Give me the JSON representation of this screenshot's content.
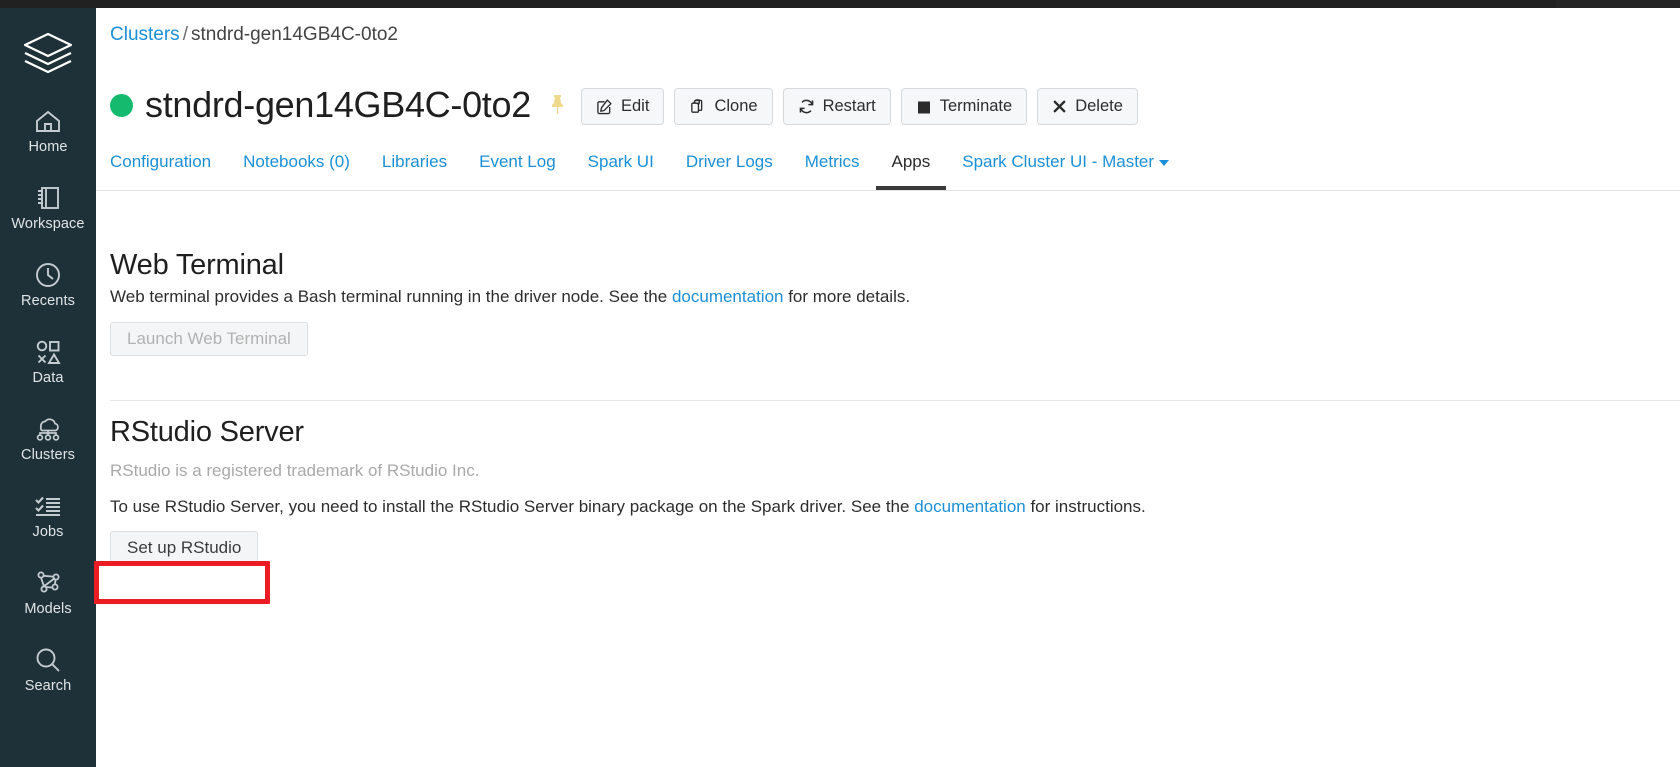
{
  "sidebar": {
    "logo_name": "databricks-logo",
    "items": [
      {
        "label": "Home",
        "icon": "home-icon"
      },
      {
        "label": "Workspace",
        "icon": "workspace-icon"
      },
      {
        "label": "Recents",
        "icon": "clock-icon"
      },
      {
        "label": "Data",
        "icon": "shapes-icon"
      },
      {
        "label": "Clusters",
        "icon": "clusters-cloud-icon"
      },
      {
        "label": "Jobs",
        "icon": "checklist-icon"
      },
      {
        "label": "Models",
        "icon": "graph-nodes-icon"
      },
      {
        "label": "Search",
        "icon": "search-icon"
      }
    ]
  },
  "breadcrumb": {
    "root": "Clusters",
    "separator": "/",
    "current": "stndrd-gen14GB4C-0to2"
  },
  "header": {
    "cluster_name": "stndrd-gen14GB4C-0to2",
    "status_color": "#15ba6e",
    "pin_icon": "pin-icon",
    "buttons": [
      {
        "label": "Edit",
        "icon": "edit-pencil-icon"
      },
      {
        "label": "Clone",
        "icon": "clone-copy-icon"
      },
      {
        "label": "Restart",
        "icon": "restart-refresh-icon"
      },
      {
        "label": "Terminate",
        "icon": "terminate-square-icon"
      },
      {
        "label": "Delete",
        "icon": "delete-x-icon"
      }
    ]
  },
  "tabs": [
    {
      "label": "Configuration",
      "active": false
    },
    {
      "label": "Notebooks (0)",
      "active": false
    },
    {
      "label": "Libraries",
      "active": false
    },
    {
      "label": "Event Log",
      "active": false
    },
    {
      "label": "Spark UI",
      "active": false
    },
    {
      "label": "Driver Logs",
      "active": false
    },
    {
      "label": "Metrics",
      "active": false
    },
    {
      "label": "Apps",
      "active": true
    },
    {
      "label": "Spark Cluster UI - Master",
      "active": false,
      "has_caret": true
    }
  ],
  "web_terminal": {
    "title": "Web Terminal",
    "description_before": "Web terminal provides a Bash terminal running in the driver node. See the ",
    "link_text": "documentation",
    "description_after": " for more details.",
    "button_label": "Launch Web Terminal",
    "button_disabled": true
  },
  "rstudio": {
    "title": "RStudio Server",
    "trademark_note": "RStudio is a registered trademark of RStudio Inc.",
    "description_before": "To use RStudio Server, you need to install the RStudio Server binary package on the Spark driver. See the ",
    "link_text": "documentation",
    "description_after": " for instructions.",
    "button_label": "Set up RStudio",
    "highlighted": true
  },
  "colors": {
    "sidebar_bg": "#1f3138",
    "link": "#1b90d6",
    "status_green": "#15ba6e",
    "highlight_red": "#ec1c24"
  }
}
